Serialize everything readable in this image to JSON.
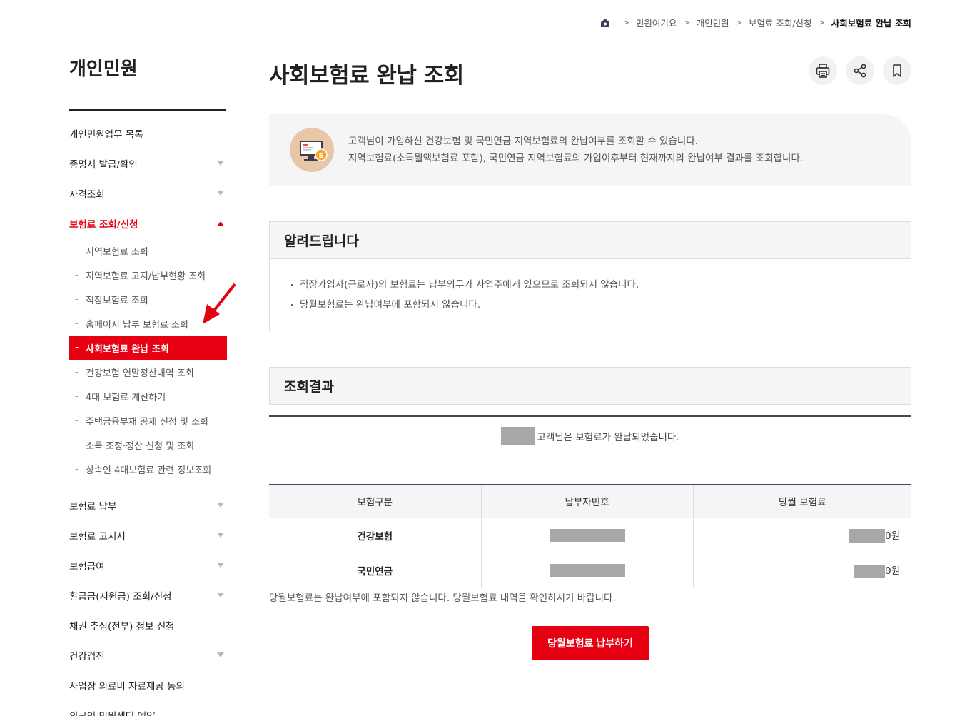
{
  "breadcrumb": {
    "items": [
      "민원여기요",
      "개인민원",
      "보험료 조회/신청"
    ],
    "current": "사회보험료 완납 조회"
  },
  "sidebar": {
    "title": "개인민원",
    "items": [
      {
        "label": "개인민원업무 목록",
        "has_arrow": false
      },
      {
        "label": "증명서 발급/확인",
        "has_arrow": true
      },
      {
        "label": "자격조회",
        "has_arrow": true
      },
      {
        "label": "보험료 조회/신청",
        "has_arrow": true,
        "open": true
      }
    ],
    "submenu": [
      "지역보험료 조회",
      "지역보험료 고지/납부현황 조회",
      "직장보험료 조회",
      "홈페이지 납부 보험료 조회",
      "사회보험료 완납 조회",
      "건강보험 연말정산내역 조회",
      "4대 보험료 계산하기",
      "주택금융부채 공제 신청 및 조회",
      "소득 조정·정산 신청 및 조회",
      "상속인 4대보험료 관련 정보조회"
    ],
    "active_sub": "사회보험료 완납 조회",
    "items_after": [
      {
        "label": "보험료 납부",
        "has_arrow": true
      },
      {
        "label": "보험료 고지서",
        "has_arrow": true
      },
      {
        "label": "보험급여",
        "has_arrow": true
      },
      {
        "label": "환급금(지원금) 조회/신청",
        "has_arrow": true
      },
      {
        "label": "채권 추심(전부) 정보 신청",
        "has_arrow": false
      },
      {
        "label": "건강검진",
        "has_arrow": true
      },
      {
        "label": "사업장 의료비 자료제공 동의",
        "has_arrow": false
      },
      {
        "label": "외국인 민원센터 예약",
        "has_arrow": false
      }
    ]
  },
  "page": {
    "title": "사회보험료 완납 조회",
    "tools": [
      "print-icon",
      "share-icon",
      "bookmark-icon"
    ]
  },
  "info": {
    "line1": "고객님이 가입하신 건강보험 및 국민연금 지역보험료의 완납여부를 조회할 수 있습니다.",
    "line2": "지역보험료(소득월액보험료 포함), 국민연금 지역보험료의 가입이후부터 현재까지의 완납여부 결과를 조회합니다."
  },
  "notice": {
    "title": "알려드립니다",
    "items": [
      "직장가입자(근로자)의 보험료는 납부의무가 사업주에게 있으므로 조회되지 않습니다.",
      "당월보험료는 완납여부에 포함되지 않습니다."
    ]
  },
  "result": {
    "title": "조회결과",
    "message": "고객님은 보험료가 완납되었습니다.",
    "columns": [
      "보험구분",
      "납부자번호",
      "당월 보험료"
    ],
    "rows": [
      {
        "type": "건강보험",
        "amount_suffix": "0원"
      },
      {
        "type": "국민연금",
        "amount_suffix": "0원"
      }
    ],
    "note": "당월보험료는 완납여부에 포함되지 않습니다. 당월보험료 내역을 확인하시기 바랍니다.",
    "pay_button": "당월보험료 납부하기"
  },
  "colors": {
    "accent": "#e60012",
    "table_border": "#444a5c",
    "panel_bg": "#f5f5f7"
  }
}
